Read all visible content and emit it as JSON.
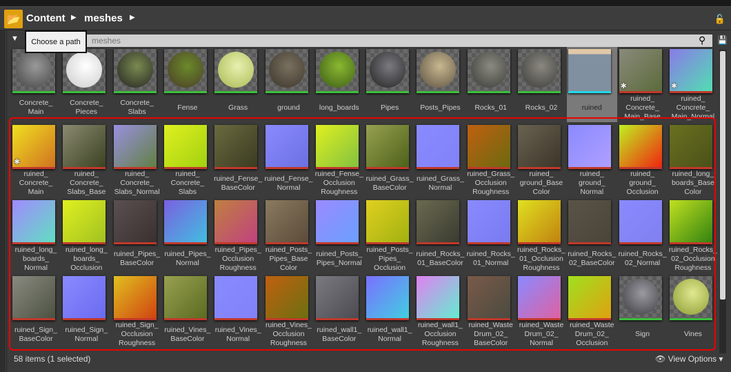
{
  "breadcrumb": {
    "items": [
      "Content",
      "meshes"
    ],
    "tooltip": "Choose a path"
  },
  "search": {
    "placeholder": "meshes"
  },
  "status": {
    "count": "58 items (1 selected)",
    "view_options": "View Options"
  },
  "colors": {
    "material_bar": "#3cbf3c",
    "texture_bar": "#c0392b",
    "level_bar": "#22d8e8",
    "highlight": "#e00000"
  },
  "assets": [
    {
      "label": "Concrete_\nMain",
      "type": "material",
      "c": [
        "#999",
        "#444"
      ]
    },
    {
      "label": "Concrete_\nPieces",
      "type": "material",
      "c": [
        "#fff",
        "#ccc"
      ]
    },
    {
      "label": "Concrete_\nSlabs",
      "type": "material",
      "c": [
        "#7a8a50",
        "#222"
      ]
    },
    {
      "label": "Fense",
      "type": "material",
      "c": [
        "#6a8a2a",
        "#4a3a28"
      ]
    },
    {
      "label": "Grass",
      "type": "material",
      "c": [
        "#e8f0b0",
        "#a8b850"
      ]
    },
    {
      "label": "ground",
      "type": "material",
      "c": [
        "#7a7060",
        "#3a3428"
      ]
    },
    {
      "label": "long_boards",
      "type": "material",
      "c": [
        "#8ab830",
        "#3a5a18"
      ]
    },
    {
      "label": "Pipes",
      "type": "material",
      "c": [
        "#7a7a80",
        "#222"
      ]
    },
    {
      "label": "Posts_Pipes",
      "type": "material",
      "c": [
        "#c8b890",
        "#5a5040"
      ]
    },
    {
      "label": "Rocks_01",
      "type": "material",
      "c": [
        "#8a8a80",
        "#3a3a38"
      ]
    },
    {
      "label": "Rocks_02",
      "type": "material",
      "c": [
        "#8a8880",
        "#3a3a38"
      ]
    },
    {
      "label": "ruined",
      "type": "level",
      "c": [
        "#e0c8a8",
        "#8090a0"
      ],
      "selected": true
    },
    {
      "label": "ruined_\nConcrete_\nMain_Base",
      "type": "texture",
      "c": [
        "#8a8a7a",
        "#5a6a3a"
      ],
      "star": true
    },
    {
      "label": "ruined_\nConcrete_\nMain_Normal",
      "type": "texture",
      "c": [
        "#8a7ae8",
        "#50e0b0"
      ],
      "star": true
    },
    {
      "label": "ruined_\nConcrete_\nMain",
      "type": "texture",
      "c": [
        "#f0e020",
        "#d07020"
      ],
      "star": true
    },
    {
      "label": "ruined_\nConcrete_\nSlabs_Base",
      "type": "texture",
      "c": [
        "#8a8a70",
        "#3a4020"
      ]
    },
    {
      "label": "ruined_\nConcrete_\nSlabs_Normal",
      "type": "texture",
      "c": [
        "#9a90e0",
        "#608040"
      ]
    },
    {
      "label": "ruined_\nConcrete_\nSlabs",
      "type": "texture",
      "c": [
        "#e0f020",
        "#a0d010"
      ]
    },
    {
      "label": "ruined_Fense_\nBaseColor",
      "type": "texture",
      "c": [
        "#6a6a40",
        "#3a3a20"
      ]
    },
    {
      "label": "ruined_Fense_\nNormal",
      "type": "texture",
      "c": [
        "#8a8aff",
        "#6a70e0"
      ]
    },
    {
      "label": "ruined_Fense_\nOcclusion\nRoughness",
      "type": "texture",
      "c": [
        "#e0f020",
        "#80c040"
      ]
    },
    {
      "label": "ruined_Grass_\nBaseColor",
      "type": "texture",
      "c": [
        "#98a050",
        "#4a6018"
      ]
    },
    {
      "label": "ruined_Grass_\nNormal",
      "type": "texture",
      "c": [
        "#8a8aff",
        "#8282f8"
      ]
    },
    {
      "label": "ruined_Grass_\nOcclusion\nRoughness",
      "type": "texture",
      "c": [
        "#c06010",
        "#6a6a10"
      ]
    },
    {
      "label": "ruined_\nground_Base\nColor",
      "type": "texture",
      "c": [
        "#6a6250",
        "#3a3428"
      ]
    },
    {
      "label": "ruined_\nground_\nNormal",
      "type": "texture",
      "c": [
        "#8a8aff",
        "#b0a0ff"
      ]
    },
    {
      "label": "ruined_\nground_\nOcclusion",
      "type": "texture",
      "c": [
        "#c0f020",
        "#f02010"
      ]
    },
    {
      "label": "ruined_long_\nboards_Base\nColor",
      "type": "texture",
      "c": [
        "#6a7020",
        "#4a5018"
      ]
    },
    {
      "label": "ruined_long_\nboards_\nNormal",
      "type": "texture",
      "c": [
        "#a08aff",
        "#60e0c0"
      ]
    },
    {
      "label": "ruined_long_\nboards_\nOcclusion",
      "type": "texture",
      "c": [
        "#e0f020",
        "#a0c020"
      ]
    },
    {
      "label": "ruined_Pipes_\nBaseColor",
      "type": "texture",
      "c": [
        "#5a5050",
        "#3a3030"
      ]
    },
    {
      "label": "ruined_Pipes_\nNormal",
      "type": "texture",
      "c": [
        "#7a60e0",
        "#40c0e0"
      ]
    },
    {
      "label": "ruined_Pipes_\nOcclusion\nRoughness",
      "type": "texture",
      "c": [
        "#c08040",
        "#c04080"
      ]
    },
    {
      "label": "ruined_Posts_\nPipes_Base\nColor",
      "type": "texture",
      "c": [
        "#8a7a60",
        "#5a4a38"
      ]
    },
    {
      "label": "ruined_Posts_\nPipes_Normal",
      "type": "texture",
      "c": [
        "#9a8aff",
        "#6aa0ff"
      ]
    },
    {
      "label": "ruined_Posts_\nPipes_\nOcclusion",
      "type": "texture",
      "c": [
        "#e0d020",
        "#a0b010"
      ]
    },
    {
      "label": "ruined_Rocks_\n01_BaseColor",
      "type": "texture",
      "c": [
        "#6a6a50",
        "#3a3a30"
      ]
    },
    {
      "label": "ruined_Rocks_\n01_Normal",
      "type": "texture",
      "c": [
        "#8a8aff",
        "#7a7af0"
      ]
    },
    {
      "label": "ruined_Rocks_\n01_Occlusion\nRoughness",
      "type": "texture",
      "c": [
        "#e0e020",
        "#c08010"
      ]
    },
    {
      "label": "ruined_Rocks_\n02_BaseColor",
      "type": "texture",
      "c": [
        "#5a5448",
        "#4a4438"
      ]
    },
    {
      "label": "ruined_Rocks_\n02_Normal",
      "type": "texture",
      "c": [
        "#8a8aff",
        "#8080f0"
      ]
    },
    {
      "label": "ruined_Rocks_\n02_Occlusion\nRoughness",
      "type": "texture",
      "c": [
        "#c0e020",
        "#308010"
      ]
    },
    {
      "label": "ruined_Sign_\nBaseColor",
      "type": "texture",
      "c": [
        "#8a8a80",
        "#4a5040"
      ]
    },
    {
      "label": "ruined_Sign_\nNormal",
      "type": "texture",
      "c": [
        "#8a8aff",
        "#6a6af0"
      ]
    },
    {
      "label": "ruined_Sign_\nOcclusion\nRoughness",
      "type": "texture",
      "c": [
        "#e0c020",
        "#d04010"
      ]
    },
    {
      "label": "ruined_Vines_\nBaseColor",
      "type": "texture",
      "c": [
        "#98a050",
        "#5a6a20"
      ]
    },
    {
      "label": "ruined_Vines_\nNormal",
      "type": "texture",
      "c": [
        "#8a8aff",
        "#8282f8"
      ]
    },
    {
      "label": "ruined_Vines_\nOcclusion\nRoughness",
      "type": "texture",
      "c": [
        "#c06010",
        "#6a7010"
      ]
    },
    {
      "label": "ruined_wall1_\nBaseColor",
      "type": "texture",
      "c": [
        "#7a7a80",
        "#4a4a50"
      ]
    },
    {
      "label": "ruined_wall1_\nNormal",
      "type": "texture",
      "c": [
        "#7a70ff",
        "#40d0e0"
      ]
    },
    {
      "label": "ruined_wall1_\nOcclusion\nRoughness",
      "type": "texture",
      "c": [
        "#e080f0",
        "#60f0d0"
      ]
    },
    {
      "label": "ruined_Waste\nDrum_02_\nBaseColor",
      "type": "texture",
      "c": [
        "#7a5a48",
        "#4a4a40"
      ]
    },
    {
      "label": "ruined_Waste\nDrum_02_\nNormal",
      "type": "texture",
      "c": [
        "#8a8aff",
        "#e060a0"
      ]
    },
    {
      "label": "ruined_Waste\nDrum_02_\nOcclusion",
      "type": "texture",
      "c": [
        "#a0e020",
        "#e0a010"
      ]
    },
    {
      "label": "Sign",
      "type": "material",
      "c": [
        "#9a9aa0",
        "#3a3a40"
      ]
    },
    {
      "label": "Vines",
      "type": "material",
      "c": [
        "#e0e890",
        "#8a9a30"
      ]
    }
  ]
}
